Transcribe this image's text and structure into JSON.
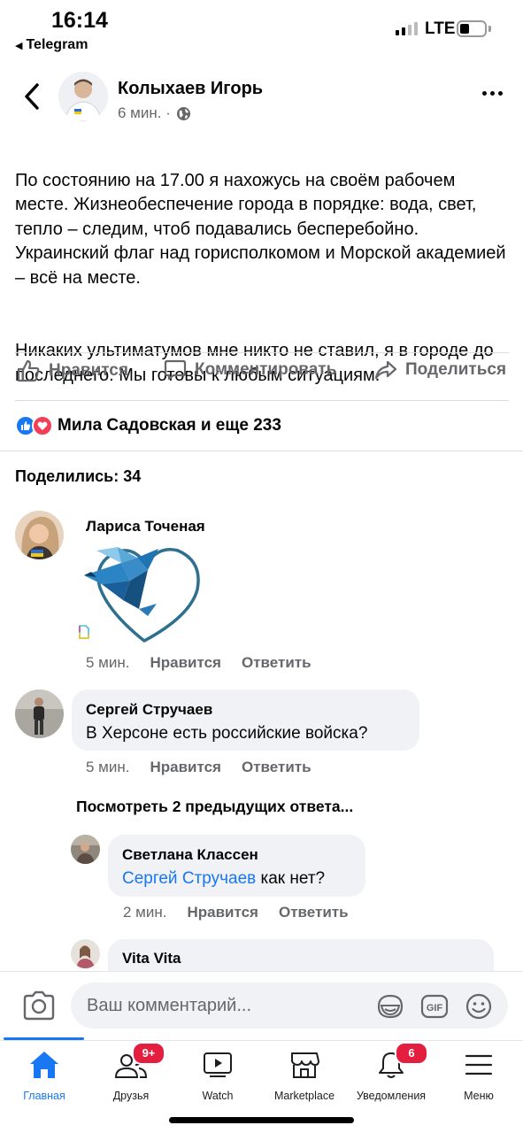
{
  "status_bar": {
    "time": "16:14",
    "back_app": "Telegram",
    "network": "LTE"
  },
  "post": {
    "author": "Колыхаев Игорь",
    "time": "6 мин. ·",
    "paragraphs": [
      "По состоянию на 17.00 я нахожусь на своём рабочем месте. Жизнеобеспечение города в порядке: вода, свет, тепло – следим, чтоб подавались бесперебойно. Украинский флаг над горисполкомом и Морской академией – всё на месте.",
      "Никаких ультиматумов мне никто не ставил, я в городе до последнего. Мы готовы к любым ситуациям."
    ],
    "actions": {
      "like": "Нравится",
      "comment": "Комментировать",
      "share": "Поделиться"
    },
    "reactions_text": "Мила Садовская и еще 233",
    "shares_text": "Поделились: 34"
  },
  "comments": [
    {
      "name": "Лариса Точеная",
      "time": "5 мин.",
      "like": "Нравится",
      "reply": "Ответить"
    },
    {
      "name": "Сергей Стручаев",
      "text": "В Херсоне есть российские войска?",
      "time": "5 мин.",
      "like": "Нравится",
      "reply": "Ответить"
    }
  ],
  "view_replies": "Посмотреть 2 предыдущих ответа...",
  "replies": [
    {
      "name": "Светлана Классен",
      "mention": "Сергей Стручаев",
      "text": " как нет?",
      "time": "2 мин.",
      "like": "Нравится",
      "reply": "Ответить"
    },
    {
      "name": "Vita Vita"
    }
  ],
  "comment_bar": {
    "placeholder": "Ваш комментарий..."
  },
  "tabs": [
    {
      "label": "Главная",
      "icon": "home-icon",
      "active": true
    },
    {
      "label": "Друзья",
      "icon": "friends-icon",
      "badge": "9+"
    },
    {
      "label": "Watch",
      "icon": "watch-icon"
    },
    {
      "label": "Marketplace",
      "icon": "marketplace-icon"
    },
    {
      "label": "Уведомления",
      "icon": "bell-icon",
      "badge": "6"
    },
    {
      "label": "Меню",
      "icon": "menu-icon"
    }
  ],
  "colors": {
    "accent": "#1877f2",
    "secondary_text": "#65676b",
    "bubble": "#f0f2f5",
    "badge": "#e41e3f"
  }
}
